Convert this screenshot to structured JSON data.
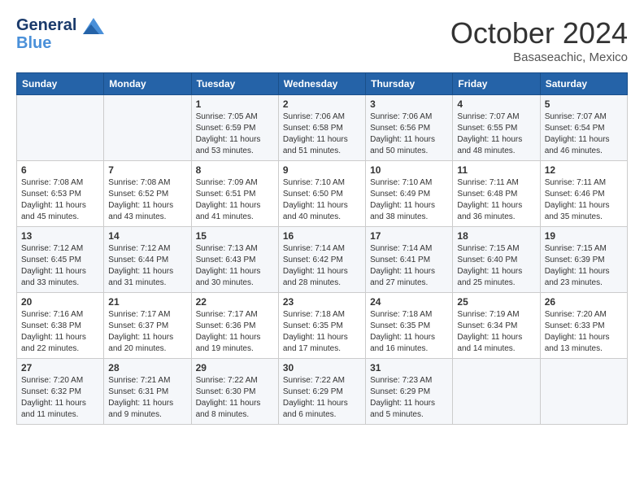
{
  "header": {
    "logo_line1": "General",
    "logo_line2": "Blue",
    "month": "October 2024",
    "location": "Basaseachic, Mexico"
  },
  "weekdays": [
    "Sunday",
    "Monday",
    "Tuesday",
    "Wednesday",
    "Thursday",
    "Friday",
    "Saturday"
  ],
  "weeks": [
    [
      {
        "day": "",
        "sunrise": "",
        "sunset": "",
        "daylight": ""
      },
      {
        "day": "",
        "sunrise": "",
        "sunset": "",
        "daylight": ""
      },
      {
        "day": "1",
        "sunrise": "Sunrise: 7:05 AM",
        "sunset": "Sunset: 6:59 PM",
        "daylight": "Daylight: 11 hours and 53 minutes."
      },
      {
        "day": "2",
        "sunrise": "Sunrise: 7:06 AM",
        "sunset": "Sunset: 6:58 PM",
        "daylight": "Daylight: 11 hours and 51 minutes."
      },
      {
        "day": "3",
        "sunrise": "Sunrise: 7:06 AM",
        "sunset": "Sunset: 6:56 PM",
        "daylight": "Daylight: 11 hours and 50 minutes."
      },
      {
        "day": "4",
        "sunrise": "Sunrise: 7:07 AM",
        "sunset": "Sunset: 6:55 PM",
        "daylight": "Daylight: 11 hours and 48 minutes."
      },
      {
        "day": "5",
        "sunrise": "Sunrise: 7:07 AM",
        "sunset": "Sunset: 6:54 PM",
        "daylight": "Daylight: 11 hours and 46 minutes."
      }
    ],
    [
      {
        "day": "6",
        "sunrise": "Sunrise: 7:08 AM",
        "sunset": "Sunset: 6:53 PM",
        "daylight": "Daylight: 11 hours and 45 minutes."
      },
      {
        "day": "7",
        "sunrise": "Sunrise: 7:08 AM",
        "sunset": "Sunset: 6:52 PM",
        "daylight": "Daylight: 11 hours and 43 minutes."
      },
      {
        "day": "8",
        "sunrise": "Sunrise: 7:09 AM",
        "sunset": "Sunset: 6:51 PM",
        "daylight": "Daylight: 11 hours and 41 minutes."
      },
      {
        "day": "9",
        "sunrise": "Sunrise: 7:10 AM",
        "sunset": "Sunset: 6:50 PM",
        "daylight": "Daylight: 11 hours and 40 minutes."
      },
      {
        "day": "10",
        "sunrise": "Sunrise: 7:10 AM",
        "sunset": "Sunset: 6:49 PM",
        "daylight": "Daylight: 11 hours and 38 minutes."
      },
      {
        "day": "11",
        "sunrise": "Sunrise: 7:11 AM",
        "sunset": "Sunset: 6:48 PM",
        "daylight": "Daylight: 11 hours and 36 minutes."
      },
      {
        "day": "12",
        "sunrise": "Sunrise: 7:11 AM",
        "sunset": "Sunset: 6:46 PM",
        "daylight": "Daylight: 11 hours and 35 minutes."
      }
    ],
    [
      {
        "day": "13",
        "sunrise": "Sunrise: 7:12 AM",
        "sunset": "Sunset: 6:45 PM",
        "daylight": "Daylight: 11 hours and 33 minutes."
      },
      {
        "day": "14",
        "sunrise": "Sunrise: 7:12 AM",
        "sunset": "Sunset: 6:44 PM",
        "daylight": "Daylight: 11 hours and 31 minutes."
      },
      {
        "day": "15",
        "sunrise": "Sunrise: 7:13 AM",
        "sunset": "Sunset: 6:43 PM",
        "daylight": "Daylight: 11 hours and 30 minutes."
      },
      {
        "day": "16",
        "sunrise": "Sunrise: 7:14 AM",
        "sunset": "Sunset: 6:42 PM",
        "daylight": "Daylight: 11 hours and 28 minutes."
      },
      {
        "day": "17",
        "sunrise": "Sunrise: 7:14 AM",
        "sunset": "Sunset: 6:41 PM",
        "daylight": "Daylight: 11 hours and 27 minutes."
      },
      {
        "day": "18",
        "sunrise": "Sunrise: 7:15 AM",
        "sunset": "Sunset: 6:40 PM",
        "daylight": "Daylight: 11 hours and 25 minutes."
      },
      {
        "day": "19",
        "sunrise": "Sunrise: 7:15 AM",
        "sunset": "Sunset: 6:39 PM",
        "daylight": "Daylight: 11 hours and 23 minutes."
      }
    ],
    [
      {
        "day": "20",
        "sunrise": "Sunrise: 7:16 AM",
        "sunset": "Sunset: 6:38 PM",
        "daylight": "Daylight: 11 hours and 22 minutes."
      },
      {
        "day": "21",
        "sunrise": "Sunrise: 7:17 AM",
        "sunset": "Sunset: 6:37 PM",
        "daylight": "Daylight: 11 hours and 20 minutes."
      },
      {
        "day": "22",
        "sunrise": "Sunrise: 7:17 AM",
        "sunset": "Sunset: 6:36 PM",
        "daylight": "Daylight: 11 hours and 19 minutes."
      },
      {
        "day": "23",
        "sunrise": "Sunrise: 7:18 AM",
        "sunset": "Sunset: 6:35 PM",
        "daylight": "Daylight: 11 hours and 17 minutes."
      },
      {
        "day": "24",
        "sunrise": "Sunrise: 7:18 AM",
        "sunset": "Sunset: 6:35 PM",
        "daylight": "Daylight: 11 hours and 16 minutes."
      },
      {
        "day": "25",
        "sunrise": "Sunrise: 7:19 AM",
        "sunset": "Sunset: 6:34 PM",
        "daylight": "Daylight: 11 hours and 14 minutes."
      },
      {
        "day": "26",
        "sunrise": "Sunrise: 7:20 AM",
        "sunset": "Sunset: 6:33 PM",
        "daylight": "Daylight: 11 hours and 13 minutes."
      }
    ],
    [
      {
        "day": "27",
        "sunrise": "Sunrise: 7:20 AM",
        "sunset": "Sunset: 6:32 PM",
        "daylight": "Daylight: 11 hours and 11 minutes."
      },
      {
        "day": "28",
        "sunrise": "Sunrise: 7:21 AM",
        "sunset": "Sunset: 6:31 PM",
        "daylight": "Daylight: 11 hours and 9 minutes."
      },
      {
        "day": "29",
        "sunrise": "Sunrise: 7:22 AM",
        "sunset": "Sunset: 6:30 PM",
        "daylight": "Daylight: 11 hours and 8 minutes."
      },
      {
        "day": "30",
        "sunrise": "Sunrise: 7:22 AM",
        "sunset": "Sunset: 6:29 PM",
        "daylight": "Daylight: 11 hours and 6 minutes."
      },
      {
        "day": "31",
        "sunrise": "Sunrise: 7:23 AM",
        "sunset": "Sunset: 6:29 PM",
        "daylight": "Daylight: 11 hours and 5 minutes."
      },
      {
        "day": "",
        "sunrise": "",
        "sunset": "",
        "daylight": ""
      },
      {
        "day": "",
        "sunrise": "",
        "sunset": "",
        "daylight": ""
      }
    ]
  ]
}
